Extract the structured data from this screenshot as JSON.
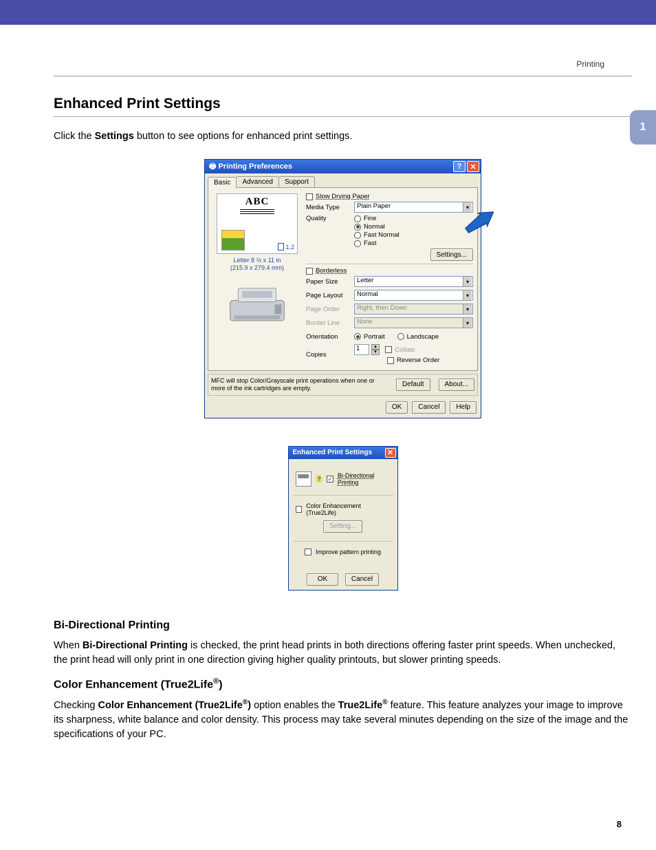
{
  "header": {
    "breadcrumb": "Printing"
  },
  "sideTab": "1",
  "pageNumber": "8",
  "title": "Enhanced Print Settings",
  "intro": {
    "pre": "Click the ",
    "bold": "Settings",
    "post": " button to see options for enhanced print settings."
  },
  "dlg1": {
    "title": "Printing Preferences",
    "tabs": [
      "Basic",
      "Advanced",
      "Support"
    ],
    "preview": {
      "abc": "ABC",
      "pagesIndicator": "1,2",
      "paperLine1": "Letter 8 ½ x 11 in",
      "paperLine2": "(215.9 x 279.4 mm)"
    },
    "labels": {
      "mediaType": "Media Type",
      "quality": "Quality",
      "slowDrying": "Slow Drying Paper",
      "borderless": "Borderless",
      "paperSize": "Paper Size",
      "pageLayout": "Page Layout",
      "pageOrder": "Page Order",
      "borderLine": "Border Line",
      "orientation": "Orientation",
      "copies": "Copies",
      "collate": "Collate",
      "reverseOrder": "Reverse Order"
    },
    "values": {
      "mediaType": "Plain Paper",
      "quality": [
        "Fine",
        "Normal",
        "Fast Normal",
        "Fast"
      ],
      "qualitySelected": 1,
      "paperSize": "Letter",
      "pageLayout": "Normal",
      "pageOrder": "Right, then Down",
      "borderLine": "None",
      "orientation": [
        "Portrait",
        "Landscape"
      ],
      "orientationSelected": 0,
      "copies": "1"
    },
    "buttons": {
      "settings": "Settings...",
      "default": "Default",
      "about": "About...",
      "ok": "OK",
      "cancel": "Cancel",
      "help": "Help"
    },
    "statusMsg": "MFC will stop Color/Grayscale print operations when one or more of the ink cartridges are empty."
  },
  "dlg2": {
    "title": "Enhanced Print Settings",
    "biDir": "Bi-Directional Printing",
    "colorEnh": "Color Enhancement (True2Life)",
    "setting": "Setting...",
    "improve": "Improve pattern printing",
    "ok": "OK",
    "cancel": "Cancel"
  },
  "section1": {
    "heading": "Bi-Directional Printing",
    "p_pre": "When ",
    "p_bold": "Bi-Directional Printing",
    "p_post": " is checked, the print head prints in both directions offering faster print speeds. When unchecked, the print head will only print in one direction giving higher quality printouts, but slower printing speeds."
  },
  "section2": {
    "heading_pre": "Color Enhancement (True2Life",
    "heading_sup": "®",
    "heading_post": ")",
    "p_pre": "Checking ",
    "p_bold_pre": "Color Enhancement (True2Life",
    "p_bold_sup": "®",
    "p_bold_post": ")",
    "p_mid1": " option enables the ",
    "p_bold2_pre": "True2Life",
    "p_bold2_sup": "®",
    "p_post": " feature. This feature analyzes your image to improve its sharpness, white balance and color density. This process may take several minutes depending on the size of the image and the specifications of your PC."
  }
}
